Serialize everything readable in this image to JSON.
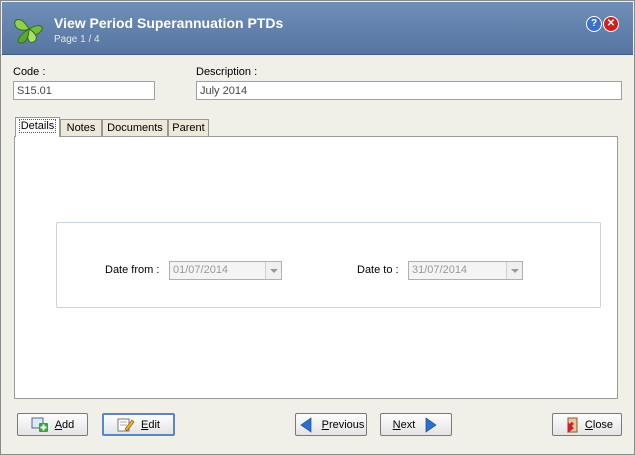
{
  "window": {
    "title": "View Period Superannuation PTDs",
    "subtitle": "Page 1 / 4"
  },
  "fields": {
    "code_label": "Code :",
    "code_value": "S15.01",
    "description_label": "Description :",
    "description_value": "July 2014"
  },
  "tabs": [
    {
      "label": "Details"
    },
    {
      "label": "Notes"
    },
    {
      "label": "Documents"
    },
    {
      "label": "Parent"
    }
  ],
  "details": {
    "date_from_label": "Date from :",
    "date_from_value": "01/07/2014",
    "date_to_label": "Date to :",
    "date_to_value": "31/07/2014"
  },
  "buttons": {
    "add_first": "A",
    "add_rest": "dd",
    "edit_first": "E",
    "edit_rest": "dit",
    "previous_first": "P",
    "previous_rest": "revious",
    "next_first": "N",
    "next_rest": "ext",
    "close_first": "C",
    "close_rest": "lose"
  },
  "icons": {
    "app": "leaf-logo-icon",
    "help": "help-icon",
    "close": "close-icon",
    "add": "add-icon",
    "edit": "edit-pencil-icon",
    "previous": "arrow-left-icon",
    "next": "arrow-right-icon",
    "close_button": "close-door-icon"
  },
  "colors": {
    "titlebar": "#5f7fab",
    "arrow": "#2d6fd0"
  }
}
